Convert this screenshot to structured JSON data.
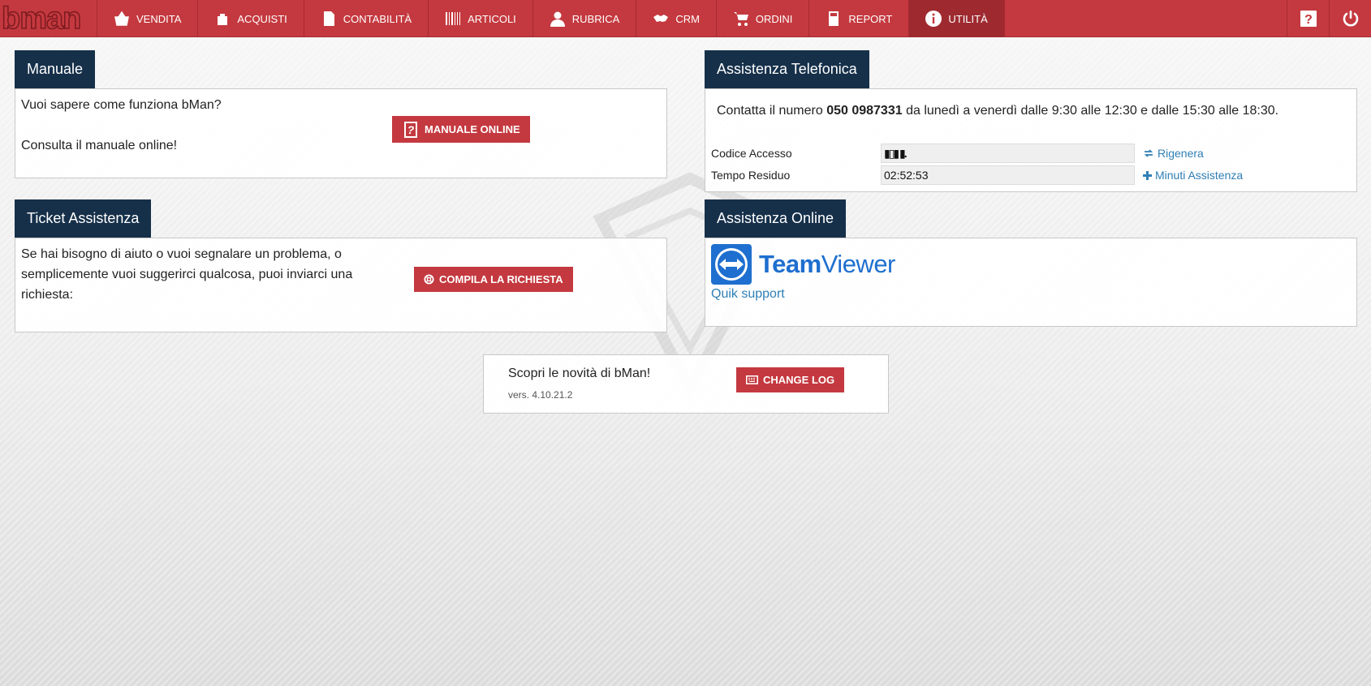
{
  "brand": {
    "logo_text": "bman"
  },
  "nav": {
    "items": [
      {
        "label": "VENDITA",
        "icon": "basket-icon"
      },
      {
        "label": "ACQUISTI",
        "icon": "bag-icon"
      },
      {
        "label": "CONTABILITÀ",
        "icon": "document-icon"
      },
      {
        "label": "ARTICOLI",
        "icon": "barcode-icon"
      },
      {
        "label": "RUBRICA",
        "icon": "user-icon"
      },
      {
        "label": "CRM",
        "icon": "handshake-icon"
      },
      {
        "label": "ORDINI",
        "icon": "cart-icon"
      },
      {
        "label": "REPORT",
        "icon": "calculator-icon"
      },
      {
        "label": "UTILITÀ",
        "icon": "info-icon",
        "active": true
      }
    ],
    "help_icon": "help-icon",
    "power_icon": "power-icon"
  },
  "manuale": {
    "title": "Manuale",
    "line1": "Vuoi sapere come funziona bMan?",
    "line2": "Consulta il manuale online!",
    "button": "MANUALE ONLINE"
  },
  "telefonica": {
    "title": "Assistenza Telefonica",
    "contact_pre": "Contatta il numero ",
    "phone": "050 0987331",
    "contact_post": " da lunedì a venerdì dalle 9:30 alle 12:30 e dalle 15:30 alle 18:30.",
    "codice_label": "Codice Accesso",
    "codice_value": "",
    "rigenera": "Rigenera",
    "tempo_label": "Tempo Residuo",
    "tempo_value": "02:52:53",
    "minuti": "Minuti Assistenza"
  },
  "ticket": {
    "title": "Ticket Assistenza",
    "line1": "Se hai bisogno di aiuto o vuoi segnalare un problema, o",
    "line2": "semplicemente vuoi suggerirci qualcosa, puoi inviarci una",
    "line3": "richiesta:",
    "button": "COMPILA LA RICHIESTA"
  },
  "online": {
    "title": "Assistenza Online",
    "tv_bold": "Team",
    "tv_rest": "Viewer",
    "link": "Quik support"
  },
  "changelog": {
    "text": "Scopri le novità di bMan!",
    "version": "vers. 4.10.21.2",
    "button": "CHANGE LOG"
  },
  "colors": {
    "brand_red": "#c4393f",
    "panel_head": "#16304a",
    "link_blue": "#2f7fb6",
    "teamviewer_blue": "#1e6fcf"
  }
}
